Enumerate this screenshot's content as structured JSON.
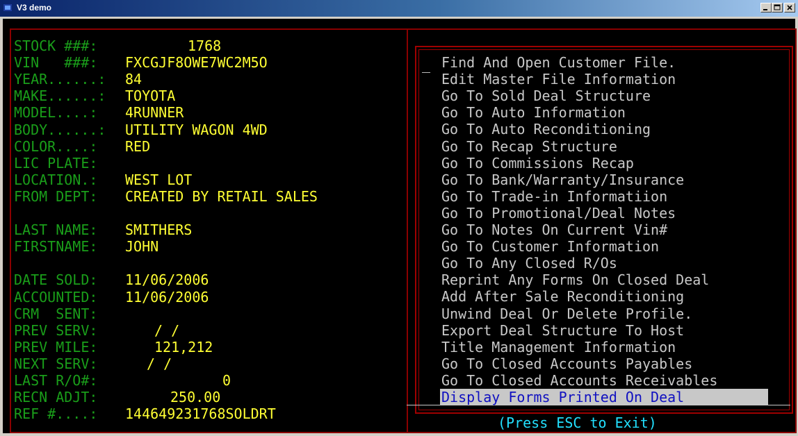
{
  "window": {
    "title": "V3 demo",
    "buttons": [
      "minimize",
      "maximize",
      "close"
    ],
    "colors": {
      "titlebar_start": "#0a246a",
      "titlebar_end": "#a6caf0",
      "border": "#8b0000",
      "label": "#1a9e1a",
      "value": "#ffff33",
      "menu": "#c8c8c8",
      "selected_bg": "#c8c8c8",
      "selected_fg": "#1010c0",
      "footer": "#22e0ff"
    }
  },
  "fields": [
    {
      "label": "STOCK ###:",
      "value": "1768"
    },
    {
      "label": "VIN   ###:",
      "value": "FXCGJF8OWE7WC2M5O"
    },
    {
      "label": "YEAR......:",
      "value": "84"
    },
    {
      "label": "MAKE......:",
      "value": "TOYOTA"
    },
    {
      "label": "MODEL....:",
      "value": "4RUNNER"
    },
    {
      "label": "BODY......:",
      "value": "UTILITY WAGON 4WD"
    },
    {
      "label": "COLOR....:",
      "value": "RED"
    },
    {
      "label": "LIC PLATE:",
      "value": ""
    },
    {
      "label": "LOCATION.:",
      "value": "WEST LOT"
    },
    {
      "label": "FROM DEPT:",
      "value": "CREATED BY RETAIL SALES"
    },
    {
      "label": "",
      "value": ""
    },
    {
      "label": "LAST NAME:",
      "value": "SMITHERS"
    },
    {
      "label": "FIRSTNAME:",
      "value": "JOHN"
    },
    {
      "label": "",
      "value": ""
    },
    {
      "label": "DATE SOLD:",
      "value": "11/06/2006"
    },
    {
      "label": "ACCOUNTED:",
      "value": "11/06/2006"
    },
    {
      "label": "CRM  SENT:",
      "value": ""
    },
    {
      "label": "PREV SERV:",
      "value": "/ /"
    },
    {
      "label": "PREV MILE:",
      "value": "121,212"
    },
    {
      "label": "NEXT SERV:",
      "value": "/ /"
    },
    {
      "label": "LAST R/O#:",
      "value": "0"
    },
    {
      "label": "RECN ADJT:",
      "value": "250.00"
    },
    {
      "label": "REF #....:",
      "value": "144649231768SOLDRT"
    }
  ],
  "menu": {
    "cursor": "_",
    "items": [
      "Find And Open Customer File.",
      "Edit Master File Information",
      "Go To Sold Deal Structure",
      "Go To Auto Information",
      "Go To Auto Reconditioning",
      "Go To Recap Structure",
      "Go To Commissions Recap",
      "Go To Bank/Warranty/Insurance",
      "Go To Trade-in Informatiion",
      "Go To Promotional/Deal Notes",
      "Go To Notes On Current Vin#",
      "Go To Customer Information",
      "Go To Any Closed R/Os",
      "Reprint Any Forms On Closed Deal",
      "Add After Sale Reconditioning",
      "Unwind Deal Or Delete Profile.",
      "Export Deal Structure To Host",
      "Title Management Information",
      "Go To Closed Accounts Payables",
      "Go To Closed Accounts Receivables",
      "Display Forms Printed On Deal"
    ],
    "selected_index": 20
  },
  "footer": {
    "text": "(Press ESC to Exit)"
  }
}
